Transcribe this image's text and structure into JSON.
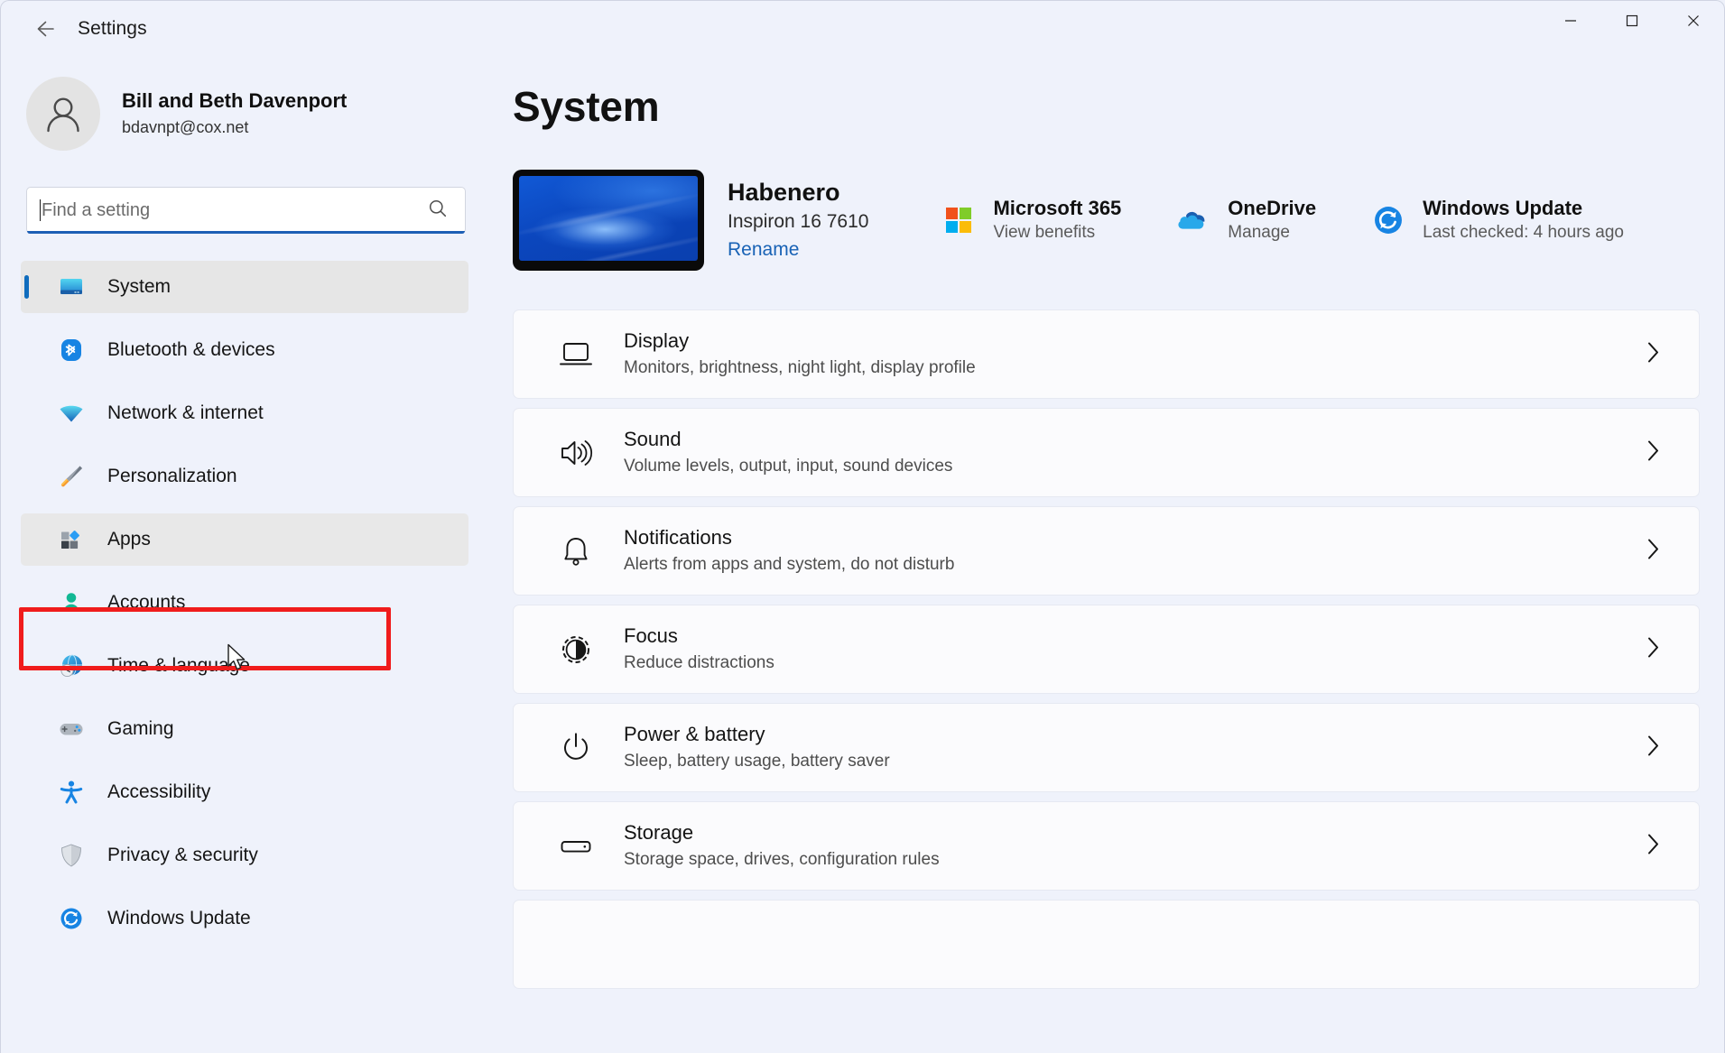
{
  "window": {
    "title": "Settings",
    "back_icon": "back-arrow-icon",
    "minimize_label": "Minimize",
    "maximize_label": "Maximize",
    "close_label": "Close"
  },
  "account": {
    "name": "Bill and Beth Davenport",
    "email": "bdavnpt@cox.net",
    "avatar_icon": "person-avatar-icon"
  },
  "search": {
    "placeholder": "Find a setting",
    "icon": "search-icon",
    "focused": true
  },
  "sidebar": {
    "items": [
      {
        "label": "System",
        "icon": "system-monitor-icon",
        "state": "selected"
      },
      {
        "label": "Bluetooth & devices",
        "icon": "bluetooth-icon",
        "state": "normal"
      },
      {
        "label": "Network & internet",
        "icon": "wifi-icon",
        "state": "normal"
      },
      {
        "label": "Personalization",
        "icon": "paintbrush-icon",
        "state": "normal"
      },
      {
        "label": "Apps",
        "icon": "apps-blocks-icon",
        "state": "hovered"
      },
      {
        "label": "Accounts",
        "icon": "person-icon",
        "state": "normal"
      },
      {
        "label": "Time & language",
        "icon": "globe-clock-icon",
        "state": "normal"
      },
      {
        "label": "Gaming",
        "icon": "gamepad-icon",
        "state": "normal"
      },
      {
        "label": "Accessibility",
        "icon": "accessibility-icon",
        "state": "normal"
      },
      {
        "label": "Privacy & security",
        "icon": "shield-icon",
        "state": "normal"
      },
      {
        "label": "Windows Update",
        "icon": "windows-update-icon",
        "state": "normal"
      }
    ]
  },
  "annotation": {
    "target": "Apps",
    "color": "#f01c1c"
  },
  "main": {
    "page_title": "System",
    "device": {
      "name": "Habenero",
      "model": "Inspiron 16 7610",
      "rename_label": "Rename",
      "thumbnail_icon": "laptop-wallpaper-thumbnail"
    },
    "status_tiles": [
      {
        "title": "Microsoft 365",
        "sub": "View benefits",
        "icon": "microsoft-logo-icon"
      },
      {
        "title": "OneDrive",
        "sub": "Manage",
        "icon": "onedrive-cloud-icon"
      },
      {
        "title": "Windows Update",
        "sub": "Last checked: 4 hours ago",
        "icon": "windows-update-icon"
      }
    ],
    "cards": [
      {
        "title": "Display",
        "sub": "Monitors, brightness, night light, display profile",
        "icon": "monitor-icon"
      },
      {
        "title": "Sound",
        "sub": "Volume levels, output, input, sound devices",
        "icon": "speaker-icon"
      },
      {
        "title": "Notifications",
        "sub": "Alerts from apps and system, do not disturb",
        "icon": "bell-icon"
      },
      {
        "title": "Focus",
        "sub": "Reduce distractions",
        "icon": "focus-icon"
      },
      {
        "title": "Power & battery",
        "sub": "Sleep, battery usage, battery saver",
        "icon": "power-icon"
      },
      {
        "title": "Storage",
        "sub": "Storage space, drives, configuration rules",
        "icon": "drive-icon"
      }
    ],
    "chevron_icon": "chevron-right-icon"
  },
  "colors": {
    "accent": "#0f6cbd",
    "background": "#eff2fb",
    "card_background": "#fbfbfd",
    "annotation_red": "#f01c1c",
    "link_blue": "#1862b5"
  }
}
